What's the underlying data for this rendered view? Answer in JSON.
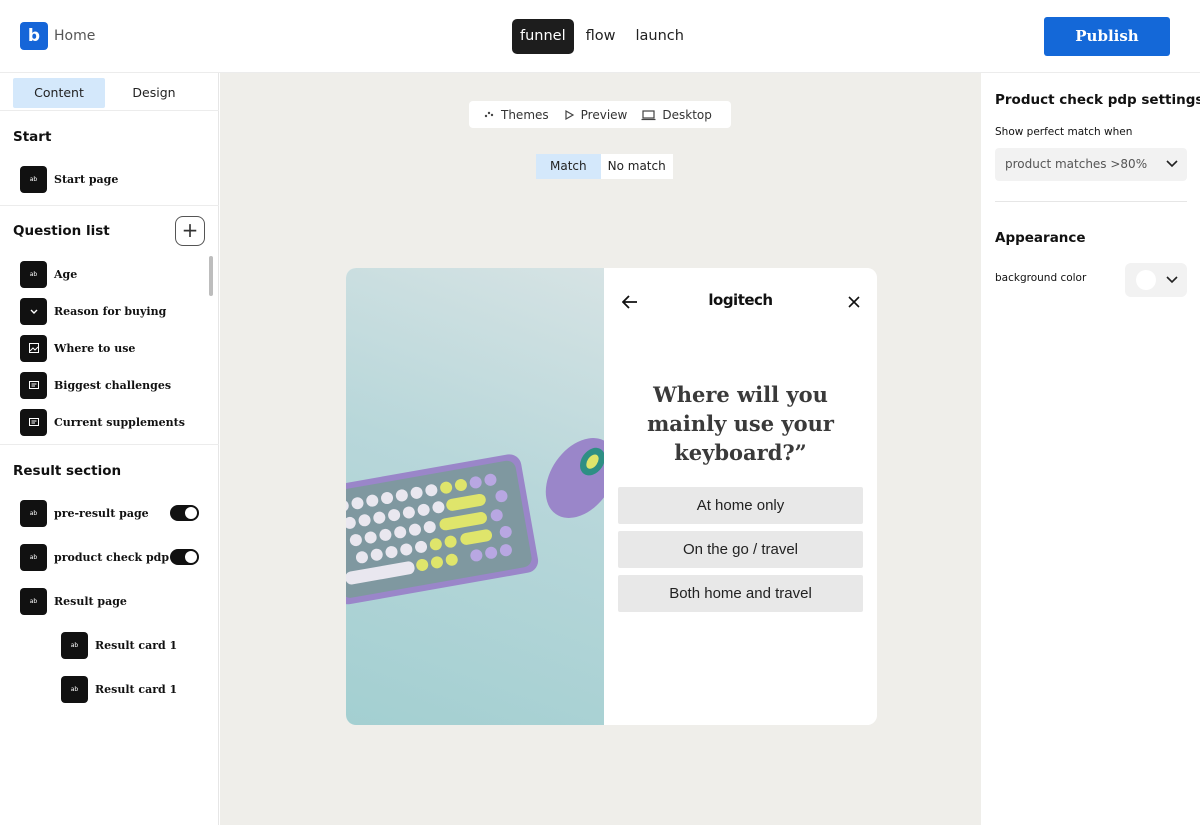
{
  "header": {
    "logo_letter": "b",
    "home_label": "Home",
    "nav_tabs": [
      {
        "label": "funnel",
        "active": true
      },
      {
        "label": "flow",
        "active": false
      },
      {
        "label": "launch",
        "active": false
      }
    ],
    "publish_label": "Publish",
    "accent_color": "#1468d8"
  },
  "sidebar": {
    "tabs": [
      {
        "label": "Content",
        "active": true
      },
      {
        "label": "Design",
        "active": false
      }
    ],
    "start": {
      "title": "Start",
      "items": [
        {
          "label": "Start page",
          "icon": "ab-text-icon"
        }
      ]
    },
    "questions": {
      "title": "Question list",
      "add_icon": "plus-icon",
      "items": [
        {
          "label": "Age",
          "icon": "ab-text-icon"
        },
        {
          "label": "Reason for buying",
          "icon": "chevron-down-icon"
        },
        {
          "label": "Where to use",
          "icon": "image-icon"
        },
        {
          "label": "Biggest challenges",
          "icon": "message-icon"
        },
        {
          "label": "Current supplements",
          "icon": "message-icon"
        }
      ]
    },
    "results": {
      "title": "Result section",
      "items": [
        {
          "label": "pre-result page",
          "icon": "ab-text-icon",
          "toggle": true
        },
        {
          "label": "product check pdp",
          "icon": "ab-text-icon",
          "toggle": true
        },
        {
          "label": "Result page",
          "icon": "ab-text-icon"
        },
        {
          "label": "Result card 1",
          "icon": "ab-text-icon"
        },
        {
          "label": "Result card 1",
          "icon": "ab-text-icon"
        }
      ]
    },
    "badge_text": "ab"
  },
  "canvas": {
    "toolbar": {
      "themes_label": "Themes",
      "preview_label": "Preview",
      "desktop_label": "Desktop"
    },
    "match_toggle": {
      "match_label": "Match",
      "no_match_label": "No match",
      "selected": "Match"
    },
    "preview": {
      "brand": "logitech",
      "question": "Where will you mainly use your keyboard?”",
      "answers": [
        "At home only",
        "On the go / travel",
        "Both home and travel"
      ]
    }
  },
  "right_panel": {
    "title": "Product check pdp settings",
    "match_label": "Show perfect match when",
    "match_value": "product matches >80%",
    "appearance_title": "Appearance",
    "bg_color_label": "background color",
    "bg_color_value": "#ffffff"
  }
}
